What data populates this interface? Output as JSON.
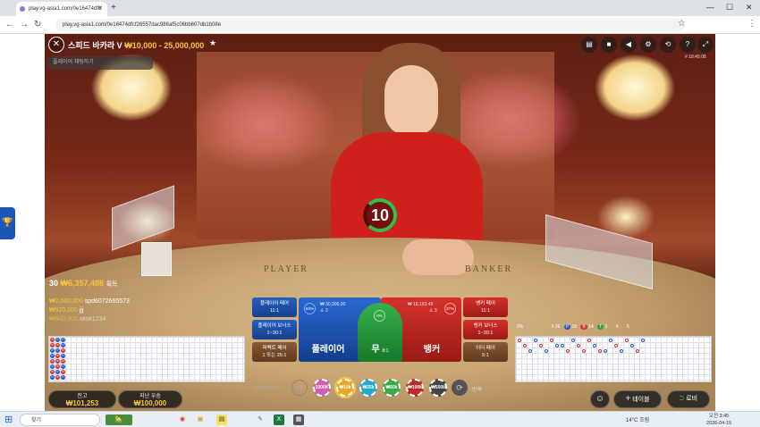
{
  "browser": {
    "tab_title": "play.vg-asia1.com/0e16474dfc",
    "url": "play.vg-asia1.com/0e16474dfcf26557dac986af5c06bb607db1b08e",
    "new_tab": "+",
    "close_tab": "✕",
    "back": "←",
    "fwd": "→",
    "reload": "↻",
    "min": "—",
    "max": "☐",
    "close": "✕",
    "bookmark": "☆",
    "menu": "⋮"
  },
  "game": {
    "title": "스피드 바카라 V",
    "limits": "₩10,000 - 25,000,000",
    "close": "✕",
    "fav": "★",
    "chat_placeholder": "플레이어 채팅하기",
    "top_icons": [
      "▤",
      "■",
      "◀",
      "⚙",
      "⟲",
      "?",
      "⤢"
    ],
    "clock": "# 18:45:08",
    "timer": "10",
    "table_player": "PLAYER",
    "table_banker": "BANKER",
    "players_count": "30",
    "players_amount": "₩6,357,488",
    "players_label": "획득",
    "winners": [
      {
        "amount": "₩2,000,000",
        "name": "spd6072665573"
      },
      {
        "amount": "₩920,000",
        "name": "jjj"
      },
      {
        "amount": "₩840,000",
        "name": "sksk1234"
      }
    ],
    "side_bets": {
      "p_pair": {
        "label": "플레이어 페어",
        "odds": "11:1"
      },
      "p_bonus": {
        "label": "플레이어 보너스",
        "odds": "1~30:1"
      },
      "perfect": {
        "label": "퍼펙트 페어",
        "odds": "1 또는 25:1"
      },
      "b_pair": {
        "label": "뱅커 페어",
        "odds": "11:1"
      },
      "b_bonus": {
        "label": "뱅커 보너스",
        "odds": "1~30:1"
      },
      "either": {
        "label": "이더 페어",
        "odds": "5:1"
      }
    },
    "main_bets": {
      "player": {
        "label": "플레이어",
        "odds": "1:1",
        "stake": "₩ 30,995.00",
        "count": "♙ 3",
        "pct": "63%"
      },
      "tie": {
        "label": "무",
        "odds": "8:1",
        "pct": "0%",
        "odds_circle": "8:1"
      },
      "banker": {
        "label": "뱅커",
        "odds": "0.95:1",
        "stake": "₩ 18,163.45",
        "count": "♙ 3",
        "pct": "37%"
      }
    },
    "road_stats": {
      "hash": "# 36",
      "p": "P",
      "p_count": "19",
      "b": "B",
      "b_count": "14",
      "t": "T",
      "t_count": "3",
      "pp_count": "4",
      "bp_count": "5",
      "bank_label": "0%"
    },
    "balance": {
      "label": "잔고",
      "value": "₩101,253"
    },
    "last_win": {
      "label": "지난 우승",
      "value": "₩100,000"
    },
    "undo_label": "실행 취소하기",
    "undo": "↺",
    "chips": [
      {
        "label": "1000K",
        "color": "#d05fb0"
      },
      {
        "label": "₩10k",
        "color": "#e8a62a"
      },
      {
        "label": "₩25k",
        "color": "#2aa8c8"
      },
      {
        "label": "₩50k",
        "color": "#3aa848"
      },
      {
        "label": "₩100k",
        "color": "#c0282a"
      },
      {
        "label": "₩500k",
        "color": "#444"
      }
    ],
    "repeat_label": "반복",
    "repeat": "⟳",
    "chat_btn": "☺",
    "tables_btn": "테이블",
    "tables_plus": "+",
    "lobby_btn": "로비",
    "lobby_icon": "⮊",
    "edge_icon": "🏆"
  },
  "bead_road": [
    [
      "B",
      "B",
      "P",
      "P",
      "B",
      "P",
      "B",
      "P"
    ],
    [
      "P",
      "B",
      "P",
      "B",
      "B",
      "B",
      "P",
      "B"
    ],
    [
      "P",
      "P",
      "B",
      "P",
      "B",
      "P",
      "B",
      "P"
    ]
  ],
  "colors": {
    "player": "#1f5ad0",
    "banker": "#d3302a",
    "tie": "#2fa14a",
    "gold": "#f5c542"
  },
  "taskbar": {
    "search": "찾기",
    "start": "⊞",
    "weather": "14°C 흐림",
    "time": "오전 3:45",
    "date": "2026-04-15",
    "icons": [
      "🏡",
      "◉",
      "▣",
      "▤",
      "✎",
      "X",
      "▦"
    ]
  }
}
